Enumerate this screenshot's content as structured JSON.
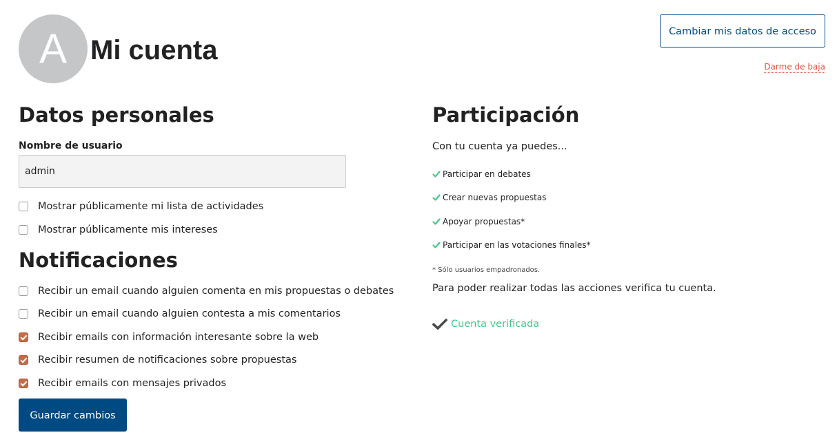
{
  "header": {
    "avatar_initial": "A",
    "title": "Mi cuenta",
    "access_button": "Cambiar mis datos de acceso",
    "unsubscribe_link": "Darme de baja"
  },
  "personal": {
    "title": "Datos personales",
    "username_label": "Nombre de usuario",
    "username_value": "admin",
    "options": [
      {
        "label": "Mostrar públicamente mi lista de actividades",
        "checked": false
      },
      {
        "label": "Mostrar públicamente mis intereses",
        "checked": false
      }
    ]
  },
  "notifications": {
    "title": "Notificaciones",
    "options": [
      {
        "label": "Recibir un email cuando alguien comenta en mis propuestas o debates",
        "checked": false
      },
      {
        "label": "Recibir un email cuando alguien contesta a mis comentarios",
        "checked": false
      },
      {
        "label": "Recibir emails con información interesante sobre la web",
        "checked": true
      },
      {
        "label": "Recibir resumen de notificaciones sobre propuestas",
        "checked": true
      },
      {
        "label": "Recibir emails con mensajes privados",
        "checked": true
      }
    ],
    "save_button": "Guardar cambios"
  },
  "participation": {
    "title": "Participación",
    "intro": "Con tu cuenta ya puedes...",
    "permissions": [
      "Participar en debates",
      "Crear nuevas propuestas",
      "Apoyar propuestas*",
      "Participar en las votaciones finales*"
    ],
    "footnote": "* Sólo usuarios empadronados.",
    "verify_text": "Para poder realizar todas las acciones verifica tu cuenta.",
    "verified_label": "Cuenta verificada"
  },
  "colors": {
    "primary": "#004a83",
    "accent": "#c76a46",
    "success": "#3ec98b",
    "danger": "#e0533f",
    "avatar_bg": "#c4c6c8"
  },
  "icons": {
    "permission_check": "check-icon",
    "verified": "checkmark-icon"
  }
}
